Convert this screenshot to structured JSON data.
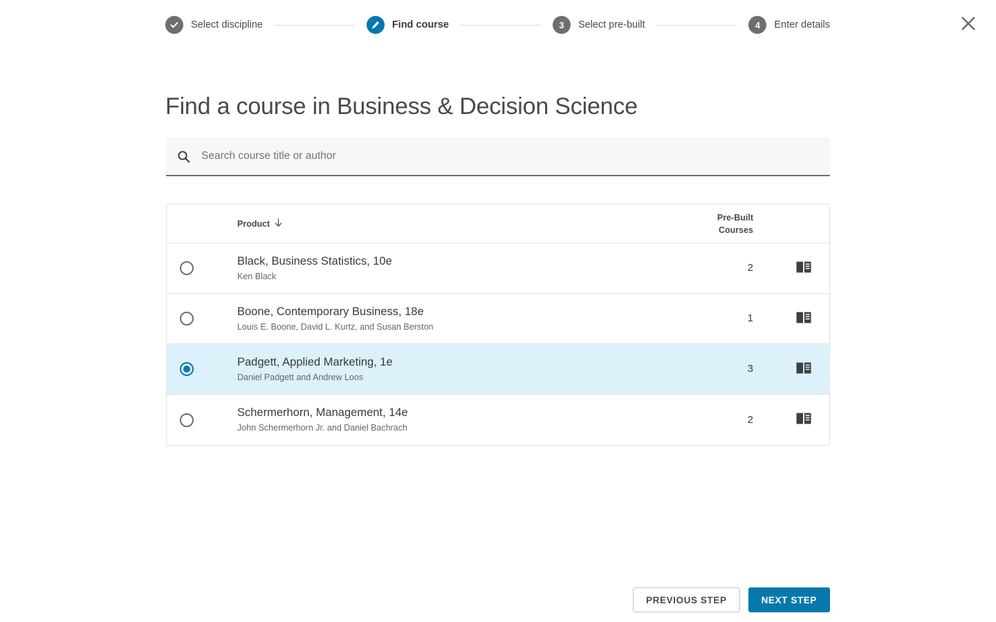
{
  "stepper": {
    "steps": [
      {
        "label": "Select discipline",
        "badge": "check-icon",
        "state": "complete"
      },
      {
        "label": "Find course",
        "badge": "pencil-icon",
        "state": "active"
      },
      {
        "label": "Select pre-built",
        "badge": "3",
        "state": "upcoming"
      },
      {
        "label": "Enter details",
        "badge": "4",
        "state": "upcoming"
      }
    ]
  },
  "close": {
    "icon": "close-icon"
  },
  "page": {
    "title": "Find a course in Business & Decision Science"
  },
  "search": {
    "icon": "search-icon",
    "placeholder": "Search course title or author",
    "value": ""
  },
  "table": {
    "headers": {
      "product": "Product",
      "sort_icon": "arrow-down-icon",
      "prebuilt": "Pre-Built Courses"
    },
    "rows": [
      {
        "title": "Black, Business Statistics, 10e",
        "authors": "Ken Black",
        "prebuilt": "2",
        "selected": false,
        "icon": "book-icon"
      },
      {
        "title": "Boone, Contemporary Business, 18e",
        "authors": "Louis E. Boone, David L. Kurtz, and Susan Berston",
        "prebuilt": "1",
        "selected": false,
        "icon": "book-icon"
      },
      {
        "title": "Padgett, Applied Marketing, 1e",
        "authors": "Daniel Padgett and Andrew Loos",
        "prebuilt": "3",
        "selected": true,
        "icon": "book-icon"
      },
      {
        "title": "Schermerhorn, Management, 14e",
        "authors": "John Schermerhorn Jr. and Daniel Bachrach",
        "prebuilt": "2",
        "selected": false,
        "icon": "book-icon"
      }
    ]
  },
  "footer": {
    "previous_label": "PREVIOUS STEP",
    "next_label": "NEXT STEP"
  },
  "colors": {
    "accent": "#0678ae",
    "selected_row": "#ddf1fb",
    "muted": "#6e6e6e",
    "border": "#e2e2e2"
  }
}
